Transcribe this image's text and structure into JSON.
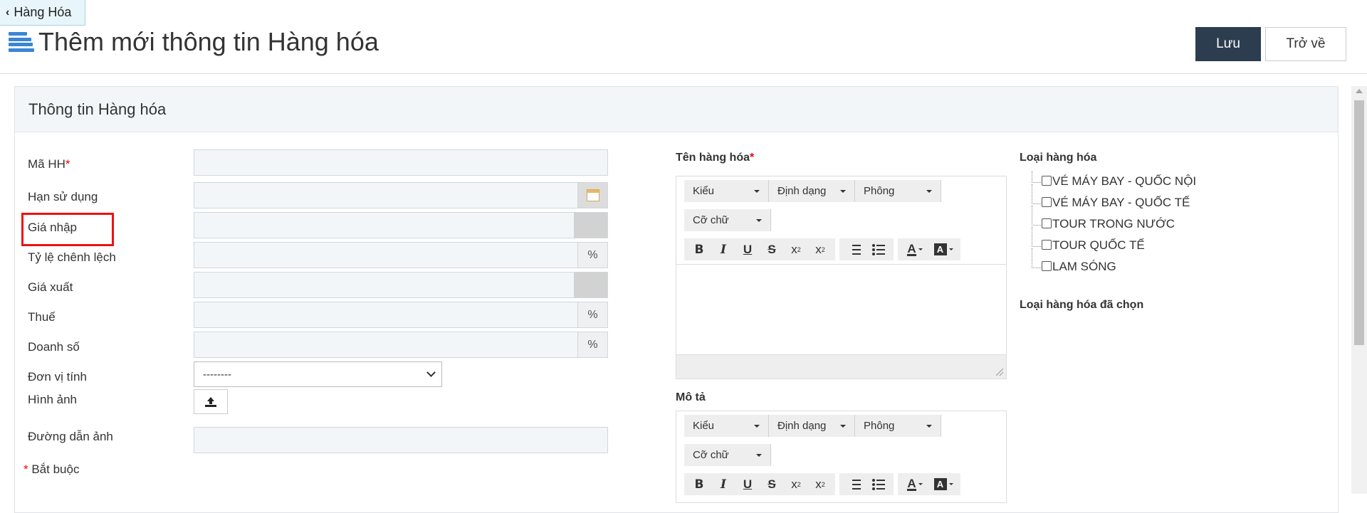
{
  "nav": {
    "back_label": "Hàng Hóa"
  },
  "page": {
    "title": "Thêm mới thông tin Hàng hóa"
  },
  "actions": {
    "save_label": "Lưu",
    "back_label": "Trở về"
  },
  "panel": {
    "title": "Thông tin Hàng hóa"
  },
  "form": {
    "ma_hh": {
      "label": "Mã HH",
      "required": "*",
      "value": ""
    },
    "han_su_dung": {
      "label": "Hạn sử dụng",
      "value": ""
    },
    "gia_nhap": {
      "label": "Giá nhập",
      "value": ""
    },
    "ty_le_chenh_lech": {
      "label": "Tỷ lệ chênh lệch",
      "value": "",
      "unit": "%"
    },
    "gia_xuat": {
      "label": "Giá xuất",
      "value": ""
    },
    "thue": {
      "label": "Thuế",
      "value": "",
      "unit": "%"
    },
    "doanh_so": {
      "label": "Doanh số",
      "value": "",
      "unit": "%"
    },
    "don_vi_tinh": {
      "label": "Đơn vị tính",
      "selected": "--------"
    },
    "hinh_anh": {
      "label": "Hình ảnh"
    },
    "duong_dan_anh": {
      "label": "Đường dẫn ảnh",
      "value": ""
    },
    "required_note": {
      "mark": "*",
      "text": " Bắt buộc"
    }
  },
  "ten_hang_hoa": {
    "label": "Tên hàng hóa",
    "required": "*"
  },
  "mo_ta": {
    "label": "Mô tả"
  },
  "editor_toolbar": {
    "style": "Kiểu",
    "format": "Định dạng",
    "font": "Phông",
    "size": "Cỡ chữ",
    "bold": "B",
    "italic": "I",
    "underline": "U",
    "strike": "S",
    "color_a": "A",
    "bg_a": "A"
  },
  "categories": {
    "label": "Loại hàng hóa",
    "items": [
      {
        "label": "VÉ MÁY BAY - QUỐC NỘI",
        "checked": false
      },
      {
        "label": "VÉ MÁY BAY - QUỐC TẾ",
        "checked": false
      },
      {
        "label": "TOUR TRONG NƯỚC",
        "checked": false
      },
      {
        "label": "TOUR QUỐC TẾ",
        "checked": false
      },
      {
        "label": "LAM SÓNG",
        "checked": false
      }
    ],
    "selected_label": "Loại hàng hóa đã chọn"
  },
  "colors": {
    "accent": "#3a86d4",
    "save_bg": "#2d3d50",
    "required": "#ee0000",
    "highlight": "#ee1111"
  }
}
